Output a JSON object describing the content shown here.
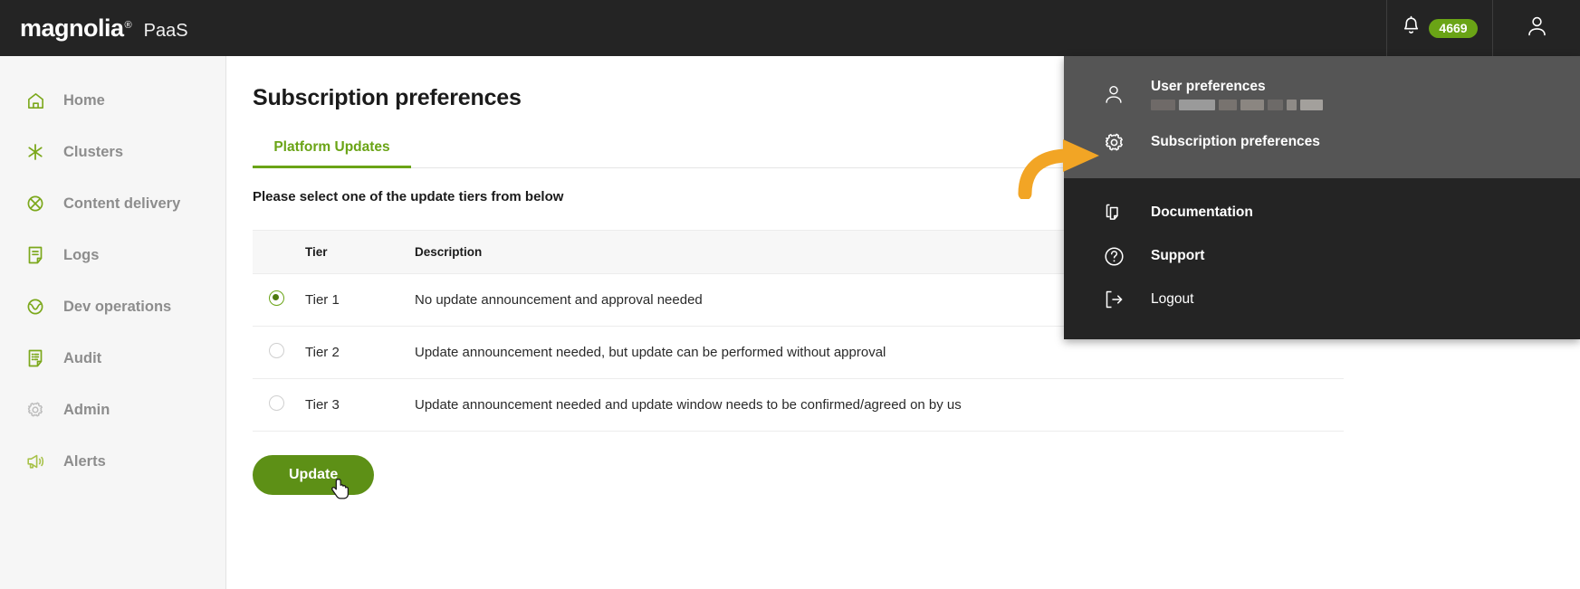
{
  "header": {
    "logo_word": "magnolia",
    "logo_registered": "®",
    "product": "PaaS",
    "notification_icon": "bell-icon",
    "notification_count": "4669",
    "user_icon": "user-avatar-icon",
    "badge_color": "#6aa416",
    "background": "#242424"
  },
  "sidebar": {
    "items": [
      {
        "label": "Home",
        "icon": "home-icon"
      },
      {
        "label": "Clusters",
        "icon": "clusters-asterisk-icon"
      },
      {
        "label": "Content delivery",
        "icon": "content-delivery-icon"
      },
      {
        "label": "Logs",
        "icon": "logs-document-icon"
      },
      {
        "label": "Dev operations",
        "icon": "dev-operations-icon"
      },
      {
        "label": "Audit",
        "icon": "audit-document-icon"
      },
      {
        "label": "Admin",
        "icon": "gear-icon"
      },
      {
        "label": "Alerts",
        "icon": "megaphone-icon"
      }
    ],
    "icon_color": "#7ca81c",
    "admin_icon_color": "#b9b9b9",
    "label_color": "#8d8d8d",
    "background": "#f6f6f6"
  },
  "main": {
    "page_title": "Subscription preferences",
    "tabs": [
      {
        "label": "Platform Updates",
        "active": true
      }
    ],
    "accent_color": "#6aa416",
    "subtitle": "Please select one of the update tiers from below",
    "table": {
      "columns": [
        "",
        "Tier",
        "Description"
      ],
      "rows": [
        {
          "selected": true,
          "tier": "Tier 1",
          "description": "No update announcement and approval needed"
        },
        {
          "selected": false,
          "tier": "Tier 2",
          "description": "Update announcement needed, but update can be performed without approval"
        },
        {
          "selected": false,
          "tier": "Tier 3",
          "description": "Update announcement needed and update window needs to be confirmed/agreed on by us"
        }
      ]
    },
    "update_button": {
      "label": "Update",
      "color": "#5d9016"
    }
  },
  "dropdown": {
    "highlight_background": "#555555",
    "background": "#242424",
    "top_group": [
      {
        "label": "User preferences",
        "icon": "user-icon",
        "redacted": true
      },
      {
        "label": "Subscription preferences",
        "icon": "gear-icon",
        "redacted": false
      }
    ],
    "bottom_group": [
      {
        "label": "Documentation",
        "icon": "documents-copy-icon",
        "bold": true
      },
      {
        "label": "Support",
        "icon": "question-circle-icon",
        "bold": true
      },
      {
        "label": "Logout",
        "icon": "logout-arrow-icon",
        "bold": false
      }
    ]
  },
  "annotation": {
    "arrow_color": "#f2a525",
    "points_to": "subscription-preferences-menu-item"
  }
}
